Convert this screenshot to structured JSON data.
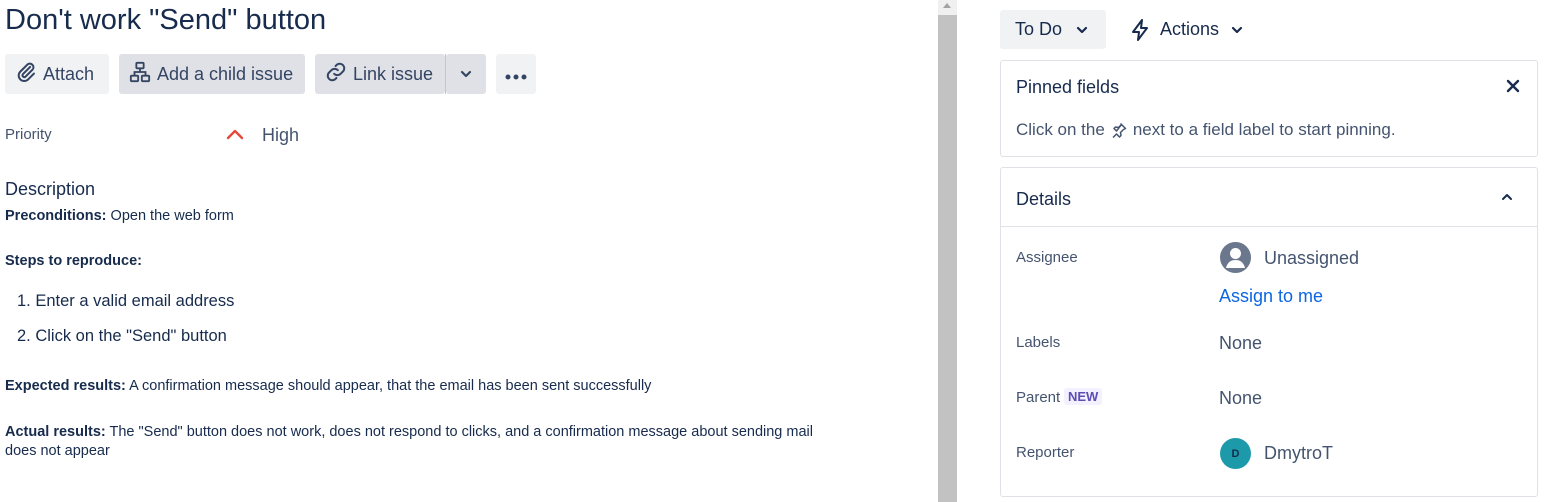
{
  "issue": {
    "title": "Don't work \"Send\" button"
  },
  "toolbar": {
    "attach_label": "Attach",
    "child_issue_label": "Add a child issue",
    "link_issue_label": "Link issue"
  },
  "priority": {
    "label": "Priority",
    "value": "High",
    "color": "#e5493a"
  },
  "description": {
    "heading": "Description",
    "preconditions_label": "Preconditions:",
    "preconditions_text": " Open the web form",
    "steps_heading": "Steps to reproduce:",
    "steps": [
      "1. Enter a valid email address",
      "2. Click on the \"Send\" button"
    ],
    "expected_label": "Expected results:",
    "expected_text": " A confirmation message should appear, that the email has been sent successfully",
    "actual_label": "Actual results:",
    "actual_text_line1": " The \"Send\" button does not work, does not respond to clicks, and a confirmation message about sending mail",
    "actual_text_line2": "does not appear"
  },
  "status": {
    "label": "To Do"
  },
  "actions": {
    "label": "Actions"
  },
  "pinned": {
    "title": "Pinned fields",
    "hint_before": "Click on the",
    "hint_after": "next to a field label to start pinning."
  },
  "details": {
    "title": "Details",
    "assignee_label": "Assignee",
    "assignee_value": "Unassigned",
    "assign_to_me": "Assign to me",
    "labels_label": "Labels",
    "labels_value": "None",
    "parent_label": "Parent",
    "parent_badge": "NEW",
    "parent_value": "None",
    "reporter_label": "Reporter",
    "reporter_initial": "D",
    "reporter_value": "DmytroT",
    "reporter_avatar_color": "#1d9aaa"
  },
  "colors": {
    "text": "#172b4d",
    "link": "#0c66e4",
    "button_bg": "#f1f2f4"
  }
}
